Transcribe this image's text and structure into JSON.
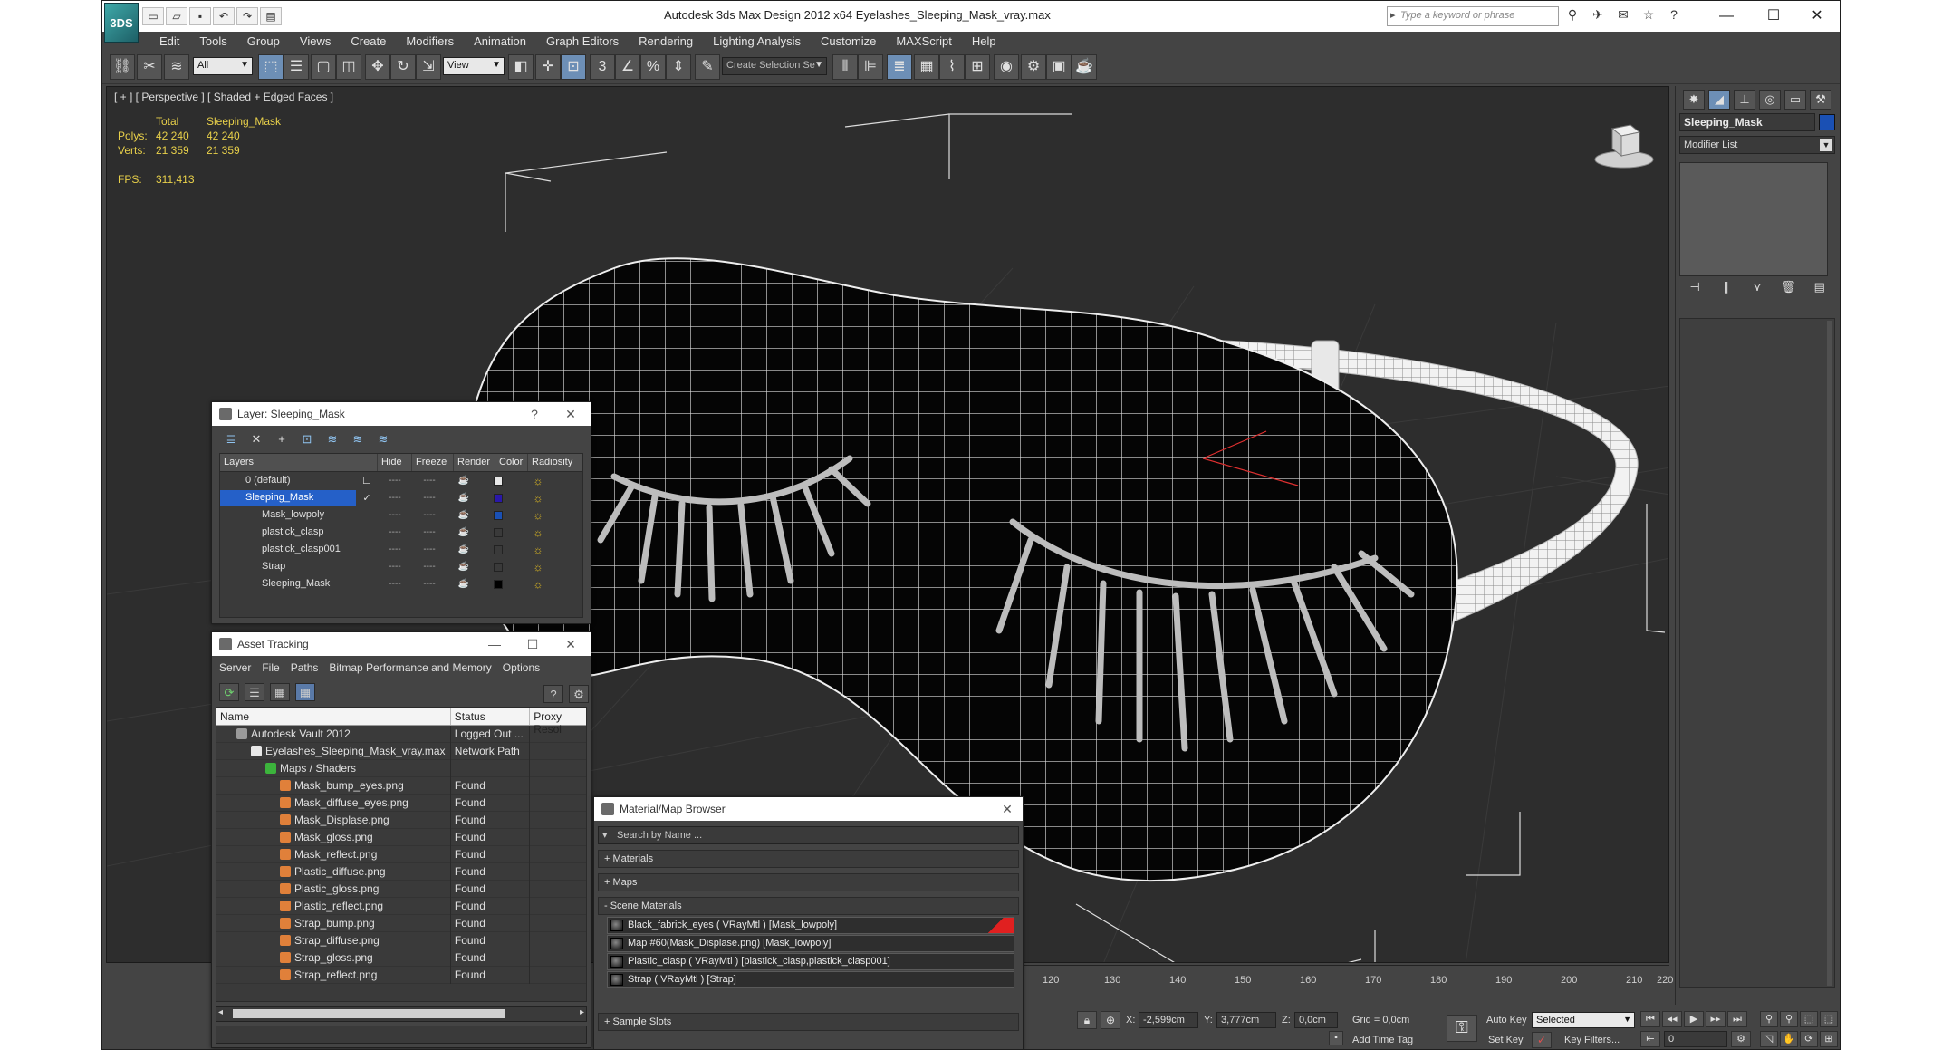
{
  "app": {
    "logo": "3DS",
    "title": "Autodesk 3ds Max Design 2012 x64       Eyelashes_Sleeping_Mask_vray.max",
    "search_placeholder": "Type a keyword or phrase"
  },
  "menu": [
    "Edit",
    "Tools",
    "Group",
    "Views",
    "Create",
    "Modifiers",
    "Animation",
    "Graph Editors",
    "Rendering",
    "Lighting Analysis",
    "Customize",
    "MAXScript",
    "Help"
  ],
  "toolbar": {
    "filter_select": "All",
    "coord_select": "View",
    "selection_set": "Create Selection Se"
  },
  "viewport": {
    "label": "[ + ] [ Perspective ] [ Shaded + Edged Faces ]",
    "stats": {
      "header_total": "Total",
      "header_obj": "Sleeping_Mask",
      "polys_label": "Polys:",
      "polys_total": "42 240",
      "polys_obj": "42 240",
      "verts_label": "Verts:",
      "verts_total": "21 359",
      "verts_obj": "21 359",
      "fps_label": "FPS:",
      "fps_value": "311,413"
    }
  },
  "timeline": {
    "ticks": [
      "120",
      "130",
      "140",
      "150",
      "160",
      "170",
      "180",
      "190",
      "200",
      "210",
      "220"
    ]
  },
  "statusbar": {
    "x_label": "X:",
    "x_value": "-2,599cm",
    "y_label": "Y:",
    "y_value": "3,777cm",
    "z_label": "Z:",
    "z_value": "0,0cm",
    "grid": "Grid = 0,0cm",
    "add_time_tag": "Add Time Tag",
    "auto_key": "Auto Key",
    "auto_key_select": "Selected",
    "set_key": "Set Key",
    "key_filters": "Key Filters...",
    "frame_value": "0"
  },
  "command_panel": {
    "object_name": "Sleeping_Mask",
    "object_color": "#1a50b4",
    "modifier_list": "Modifier List"
  },
  "layer_panel": {
    "title": "Layer: Sleeping_Mask",
    "columns": [
      "Layers",
      "Hide",
      "Freeze",
      "Render",
      "Color",
      "Radiosity"
    ],
    "rows": [
      {
        "name": "0 (default)",
        "color": "#e8e8e8",
        "selected": false
      },
      {
        "name": "Sleeping_Mask",
        "color": "#2a18a8",
        "selected": true
      },
      {
        "name": "Mask_lowpoly",
        "color": "#1a50b4",
        "selected": false
      },
      {
        "name": "plastick_clasp",
        "color": "#3a3a3a",
        "selected": false
      },
      {
        "name": "plastick_clasp001",
        "color": "#3a3a3a",
        "selected": false
      },
      {
        "name": "Strap",
        "color": "#3a3a3a",
        "selected": false
      },
      {
        "name": "Sleeping_Mask",
        "color": "#000000",
        "selected": false
      }
    ]
  },
  "asset_panel": {
    "title": "Asset Tracking",
    "menu": [
      "Server",
      "File",
      "Paths",
      "Bitmap Performance and Memory",
      "Options"
    ],
    "columns": [
      "Name",
      "Status",
      "Proxy Resol"
    ],
    "rows": [
      {
        "name": "Autodesk Vault 2012",
        "status": "Logged Out ...",
        "indent": 1
      },
      {
        "name": "Eyelashes_Sleeping_Mask_vray.max",
        "status": "Network Path",
        "indent": 2
      },
      {
        "name": "Maps / Shaders",
        "status": "",
        "indent": 3
      },
      {
        "name": "Mask_bump_eyes.png",
        "status": "Found",
        "indent": 4
      },
      {
        "name": "Mask_diffuse_eyes.png",
        "status": "Found",
        "indent": 4
      },
      {
        "name": "Mask_Displase.png",
        "status": "Found",
        "indent": 4
      },
      {
        "name": "Mask_gloss.png",
        "status": "Found",
        "indent": 4
      },
      {
        "name": "Mask_reflect.png",
        "status": "Found",
        "indent": 4
      },
      {
        "name": "Plastic_diffuse.png",
        "status": "Found",
        "indent": 4
      },
      {
        "name": "Plastic_gloss.png",
        "status": "Found",
        "indent": 4
      },
      {
        "name": "Plastic_reflect.png",
        "status": "Found",
        "indent": 4
      },
      {
        "name": "Strap_bump.png",
        "status": "Found",
        "indent": 4
      },
      {
        "name": "Strap_diffuse.png",
        "status": "Found",
        "indent": 4
      },
      {
        "name": "Strap_gloss.png",
        "status": "Found",
        "indent": 4
      },
      {
        "name": "Strap_reflect.png",
        "status": "Found",
        "indent": 4
      }
    ]
  },
  "material_panel": {
    "title": "Material/Map Browser",
    "search_placeholder": "Search by Name ...",
    "groups": {
      "materials": "+ Materials",
      "maps": "+ Maps",
      "scene": "- Scene Materials",
      "sample": "+ Sample Slots"
    },
    "items": [
      "Black_fabrick_eyes  ( VRayMtl ) [Mask_lowpoly]",
      "Map #60(Mask_Displase.png) [Mask_lowpoly]",
      "Plastic_clasp  ( VRayMtl ) [plastick_clasp,plastick_clasp001]",
      "Strap  ( VRayMtl ) [Strap]"
    ]
  }
}
